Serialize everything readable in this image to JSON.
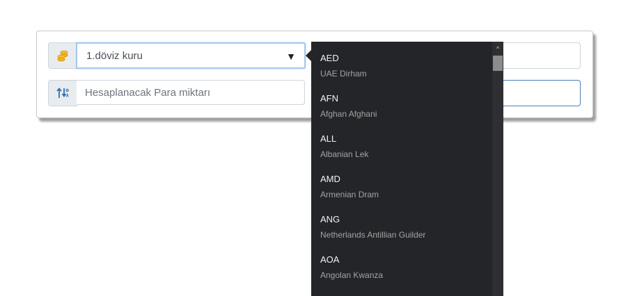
{
  "converter": {
    "currency_select": {
      "value": "1.döviz kuru"
    },
    "amount_input": {
      "placeholder": "Hesaplanacak Para miktarı",
      "value": ""
    }
  },
  "currency_dropdown": {
    "options": [
      {
        "code": "AED",
        "name": "UAE Dirham"
      },
      {
        "code": "AFN",
        "name": "Afghan Afghani"
      },
      {
        "code": "ALL",
        "name": "Albanian Lek"
      },
      {
        "code": "AMD",
        "name": "Armenian Dram"
      },
      {
        "code": "ANG",
        "name": "Netherlands Antillian Guilder"
      },
      {
        "code": "AOA",
        "name": "Angolan Kwanza"
      }
    ]
  },
  "icons": {
    "coins": "coins-icon",
    "sort": "sort-icon",
    "caret": "caret-down-icon"
  },
  "colors": {
    "dropdown_bg": "#242529",
    "coin_gold": "#f0b429",
    "sort_blue": "#2f6fb7",
    "focus_border": "#a9c8ec",
    "active_border": "#4a7fb8"
  }
}
